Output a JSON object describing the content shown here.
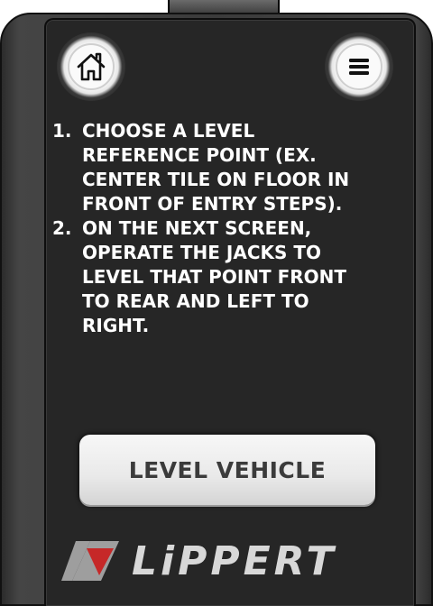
{
  "header": {
    "home_icon": "home-icon",
    "menu_icon": "hamburger-menu-icon"
  },
  "instructions": [
    {
      "number": "1.",
      "text": "CHOOSE A LEVEL REFERENCE POINT (EX. CENTER TILE ON FLOOR IN FRONT OF ENTRY STEPS)."
    },
    {
      "number": "2.",
      "text": "ON THE NEXT SCREEN, OPERATE THE JACKS TO LEVEL THAT POINT FRONT TO REAR AND LEFT TO RIGHT."
    }
  ],
  "actions": {
    "level_vehicle_label": "LEVEL VEHICLE"
  },
  "brand": {
    "name": "LiPPERT",
    "accent_color": "#c62828",
    "mark_color": "#9e9e9e"
  }
}
